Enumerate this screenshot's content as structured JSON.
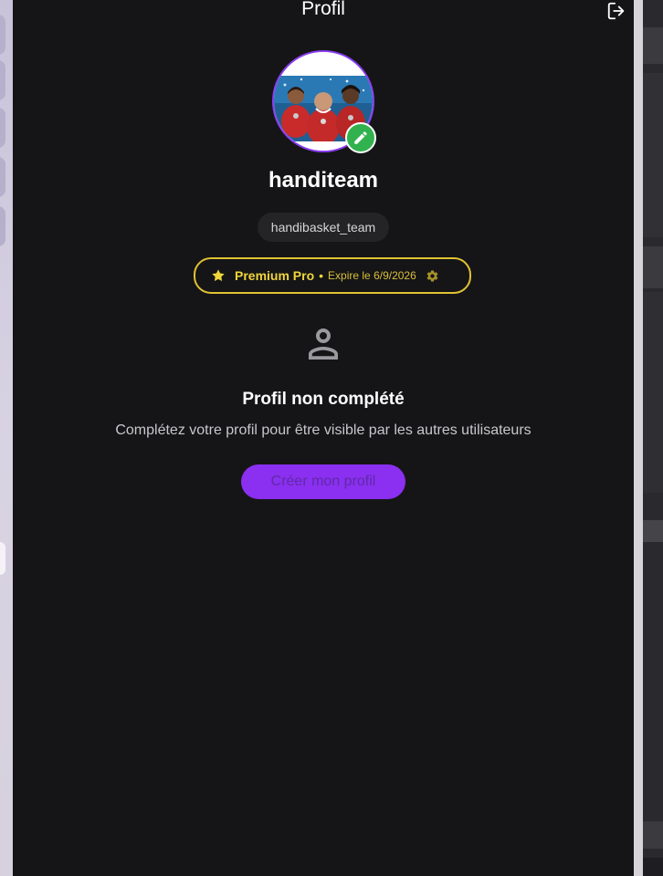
{
  "header": {
    "title": "Profil",
    "logout_icon": "logout-icon"
  },
  "profile": {
    "name": "handiteam",
    "username": "handibasket_team",
    "avatar_alt": "Photo de profil",
    "edit_icon": "pencil-icon"
  },
  "premium": {
    "plan": "Premium Pro",
    "separator": "•",
    "expire": "Expire le 6/9/2026",
    "star_icon": "star-icon",
    "settings_icon": "gear-icon",
    "color": "#f1d53a"
  },
  "empty_state": {
    "icon": "person-icon",
    "title": "Profil non complété",
    "description": "Complétez votre profil pour être visible par les autres utilisateurs",
    "button_label": "Créer mon profil"
  },
  "colors": {
    "panel_bg": "#151517",
    "accent": "#8b2ff0",
    "success": "#32b24f",
    "gold": "#e0c232"
  }
}
